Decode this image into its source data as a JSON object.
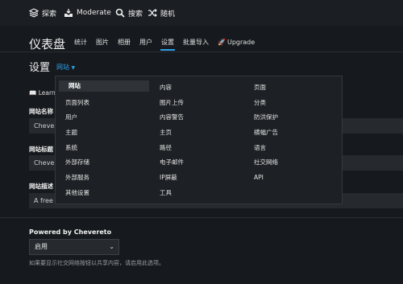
{
  "topbar": {
    "explore": "探索",
    "moderate": "Moderate",
    "search": "搜索",
    "random": "随机"
  },
  "dashboard": {
    "title": "仪表盘",
    "tabs": [
      "统计",
      "图片",
      "相册",
      "用户",
      "设置",
      "批量导入",
      "Upgrade"
    ],
    "active_tab": "设置"
  },
  "settings": {
    "title": "设置",
    "section_selected": "网站",
    "learn_label": "Learn",
    "fields": [
      {
        "label": "网站名称",
        "value": "Chevereto"
      },
      {
        "label": "网站标题",
        "value": "Chevereto"
      },
      {
        "label": "网站描述",
        "value": "A free i"
      }
    ]
  },
  "section_menu": {
    "columns": [
      [
        "网站",
        "页面列表",
        "用户",
        "主题",
        "系统",
        "外部存储",
        "外部服务",
        "其他设置"
      ],
      [
        "内容",
        "图片上传",
        "内容警告",
        "主页",
        "路径",
        "电子邮件",
        "IP屏蔽",
        "工具"
      ],
      [
        "页面",
        "分类",
        "防洪保护",
        "横幅广告",
        "语言",
        "社交网络",
        "API"
      ]
    ],
    "selected": "网站"
  },
  "powered_by": {
    "label": "Powered by Chevereto",
    "value": "启用",
    "help": "如果要显示社交网络按钮以共享内容，请启用此选项。"
  },
  "colors": {
    "accent": "#2e9fe6",
    "background": "#16191d",
    "menu_bg": "#1d2024",
    "upgrade_rocket": "#e05b2b"
  }
}
